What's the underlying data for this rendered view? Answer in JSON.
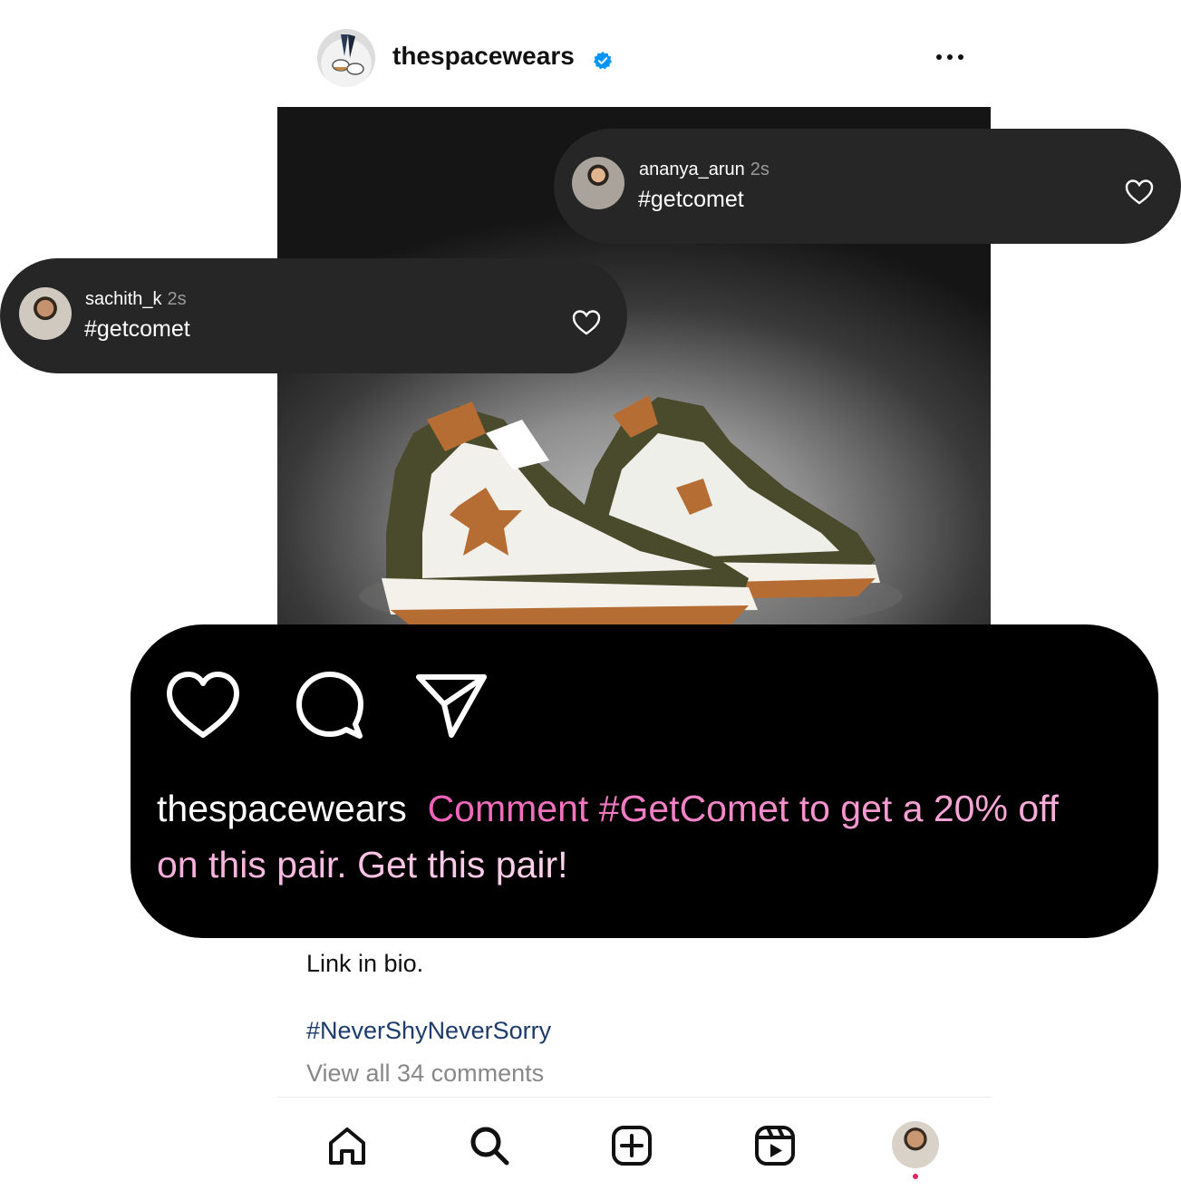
{
  "post": {
    "username": "thespacewears",
    "verified": true,
    "more_icon": "more-horizontal-icon",
    "caption_continued": "Link in bio.",
    "hashtag": "#NeverShyNeverSorry",
    "view_all_comments": "View all 34 comments"
  },
  "comments": [
    {
      "user": "ananya_arun",
      "time": "2s",
      "text": "#getcomet"
    },
    {
      "user": "sachith_k",
      "time": "2s",
      "text": "#getcomet"
    }
  ],
  "overlay": {
    "caption_user": "thespacewears",
    "caption_text": "Comment #GetComet to get a 20% off on this pair. Get this pair!",
    "actions": [
      "heart-icon",
      "comment-icon",
      "send-icon"
    ]
  },
  "nav": {
    "items": [
      "home-icon",
      "search-icon",
      "create-icon",
      "reels-icon",
      "profile-avatar"
    ],
    "notification_color": "#e0245e"
  },
  "colors": {
    "caption_gradient_start": "#f062b8",
    "caption_gradient_end": "#ffd5ec",
    "hashtag": "#1d3b6b",
    "verified": "#0095f6"
  }
}
